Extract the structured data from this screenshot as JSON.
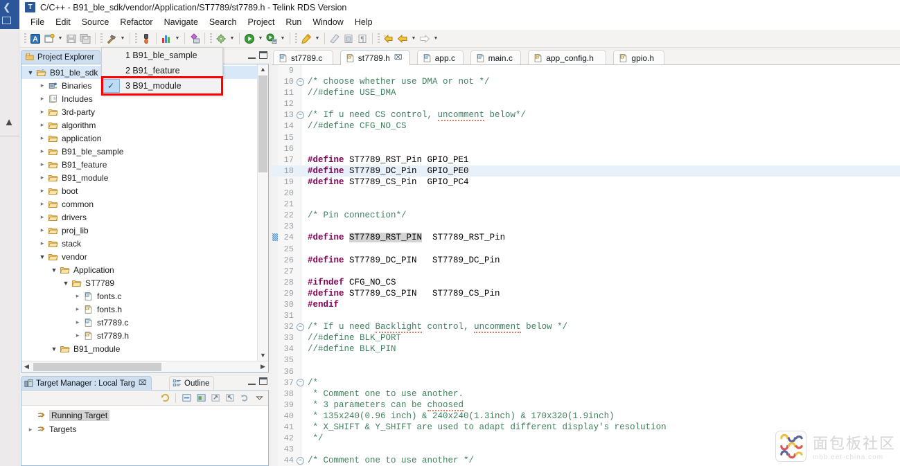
{
  "window": {
    "app_initial": "T",
    "title": "C/C++ - B91_ble_sdk/vendor/Application/ST7789/st7789.h - Telink RDS Version"
  },
  "menubar": {
    "items": [
      {
        "label": "File"
      },
      {
        "label": "Edit"
      },
      {
        "label": "Source"
      },
      {
        "label": "Refactor"
      },
      {
        "label": "Navigate"
      },
      {
        "label": "Search"
      },
      {
        "label": "Project"
      },
      {
        "label": "Run"
      },
      {
        "label": "Window"
      },
      {
        "label": "Help"
      }
    ]
  },
  "toolbar": {
    "icons": [
      "perspective-icon",
      "new-file-icon",
      "new-file-dropdown",
      "save-icon",
      "save-all-icon",
      "build-hammer-icon",
      "build-dropdown",
      "debug-flame-icon",
      "chart-icon",
      "chart-dropdown",
      "link-editor-icon",
      "build-settings-gear-icon",
      "build-settings-dropdown",
      "run-icon",
      "run-dropdown",
      "debug-icon",
      "debug-dropdown",
      "marker-icon",
      "marker-dropdown",
      "eraser-icon",
      "block-select-icon",
      "pilcrow-icon",
      "back-star-icon",
      "back-arrow-icon",
      "back-dropdown",
      "forward-arrow-icon",
      "forward-dropdown"
    ]
  },
  "dropdown": {
    "items": [
      {
        "label": "1 B91_ble_sample",
        "checked": false
      },
      {
        "label": "2 B91_feature",
        "checked": false
      },
      {
        "label": "3 B91_module",
        "checked": true
      }
    ],
    "check_glyph": "✓",
    "highlight_color": "#ff0000"
  },
  "project_explorer": {
    "tab_label": "Project Explorer",
    "tab_icon": "folder-explorer-icon",
    "minimize_label": "",
    "maximize_label": "",
    "tree": [
      {
        "label": "B91_ble_sdk",
        "depth": 0,
        "twisty": "open",
        "icon": "project-icon",
        "selected": true
      },
      {
        "label": "Binaries",
        "depth": 1,
        "twisty": "closed",
        "icon": "binaries-icon",
        "selected": false
      },
      {
        "label": "Includes",
        "depth": 1,
        "twisty": "closed",
        "icon": "includes-icon",
        "selected": false
      },
      {
        "label": "3rd-party",
        "depth": 1,
        "twisty": "closed",
        "icon": "folder-icon",
        "selected": false
      },
      {
        "label": "algorithm",
        "depth": 1,
        "twisty": "closed",
        "icon": "folder-icon",
        "selected": false
      },
      {
        "label": "application",
        "depth": 1,
        "twisty": "closed",
        "icon": "folder-icon",
        "selected": false
      },
      {
        "label": "B91_ble_sample",
        "depth": 1,
        "twisty": "closed",
        "icon": "folder-icon",
        "selected": false
      },
      {
        "label": "B91_feature",
        "depth": 1,
        "twisty": "closed",
        "icon": "folder-icon",
        "selected": false
      },
      {
        "label": "B91_module",
        "depth": 1,
        "twisty": "closed",
        "icon": "folder-icon",
        "selected": false
      },
      {
        "label": "boot",
        "depth": 1,
        "twisty": "closed",
        "icon": "folder-icon",
        "selected": false
      },
      {
        "label": "common",
        "depth": 1,
        "twisty": "closed",
        "icon": "folder-icon",
        "selected": false
      },
      {
        "label": "drivers",
        "depth": 1,
        "twisty": "closed",
        "icon": "folder-icon",
        "selected": false
      },
      {
        "label": "proj_lib",
        "depth": 1,
        "twisty": "closed",
        "icon": "folder-icon",
        "selected": false
      },
      {
        "label": "stack",
        "depth": 1,
        "twisty": "closed",
        "icon": "folder-icon",
        "selected": false
      },
      {
        "label": "vendor",
        "depth": 1,
        "twisty": "open",
        "icon": "folder-icon",
        "selected": false
      },
      {
        "label": "Application",
        "depth": 2,
        "twisty": "open",
        "icon": "folder-icon",
        "selected": false
      },
      {
        "label": "ST7789",
        "depth": 3,
        "twisty": "open",
        "icon": "folder-icon",
        "selected": false
      },
      {
        "label": "fonts.c",
        "depth": 4,
        "twisty": "closed",
        "icon": "c-file-icon",
        "selected": false
      },
      {
        "label": "fonts.h",
        "depth": 4,
        "twisty": "closed",
        "icon": "h-file-icon",
        "selected": false
      },
      {
        "label": "st7789.c",
        "depth": 4,
        "twisty": "closed",
        "icon": "c-file-icon",
        "selected": false
      },
      {
        "label": "st7789.h",
        "depth": 4,
        "twisty": "closed",
        "icon": "h-file-icon",
        "selected": false
      },
      {
        "label": "B91_module",
        "depth": 2,
        "twisty": "open",
        "icon": "folder-icon",
        "selected": false
      }
    ]
  },
  "target_manager": {
    "active_tab": "Target Manager : Local Targ",
    "active_tab_icon": "target-manager-icon",
    "active_tab_close": "⌧",
    "inactive_tab": "Outline",
    "inactive_tab_icon": "outline-icon",
    "toolbar_icons": [
      "refresh-targets-icon",
      "collapse-all-icon",
      "new-target-icon",
      "import-icon",
      "export-icon",
      "sync-icon",
      "view-menu-icon"
    ],
    "rows": [
      {
        "label": "Running Target",
        "icon": "target-icon",
        "twisty": "none",
        "selected": true
      },
      {
        "label": "Targets",
        "icon": "target-icon",
        "twisty": "closed",
        "selected": false
      }
    ]
  },
  "editor": {
    "tabs": [
      {
        "label": "st7789.c",
        "icon": "c-file-icon",
        "active": false,
        "dirty": false
      },
      {
        "label": "st7789.h",
        "icon": "h-file-icon",
        "active": true,
        "dirty": false,
        "close": "⌧"
      },
      {
        "label": "app.c",
        "icon": "c-file-icon",
        "active": false,
        "dirty": false
      },
      {
        "label": "main.c",
        "icon": "c-file-icon",
        "active": false,
        "dirty": false
      },
      {
        "label": "app_config.h",
        "icon": "h-file-icon",
        "active": false,
        "dirty": false
      },
      {
        "label": "gpio.h",
        "icon": "h-file-icon",
        "active": false,
        "dirty": false
      }
    ],
    "lines": [
      {
        "n": "9",
        "text": "",
        "fold": null,
        "hl": false
      },
      {
        "n": "10",
        "text": "/* choose whether use DMA or not */",
        "fold": "minus",
        "hl": false,
        "style": "comment"
      },
      {
        "n": "11",
        "text": "//#define USE_DMA",
        "fold": null,
        "hl": false,
        "style": "comment"
      },
      {
        "n": "12",
        "text": "",
        "fold": null,
        "hl": false
      },
      {
        "n": "13",
        "text": "/* If u need CS control, uncomment below*/",
        "fold": "minus",
        "hl": false,
        "style": "comment-spell",
        "spell": "uncomment"
      },
      {
        "n": "14",
        "text": "//#define CFG_NO_CS",
        "fold": null,
        "hl": false,
        "style": "comment"
      },
      {
        "n": "15",
        "text": "",
        "fold": null,
        "hl": false
      },
      {
        "n": "16",
        "text": "",
        "fold": null,
        "hl": false
      },
      {
        "n": "17",
        "text": "#define ST7789_RST_Pin GPIO_PE1",
        "fold": null,
        "hl": false,
        "style": "define"
      },
      {
        "n": "18",
        "text": "#define ST7789_DC_Pin  GPIO_PE0",
        "fold": null,
        "hl": true,
        "style": "define"
      },
      {
        "n": "19",
        "text": "#define ST7789_CS_Pin  GPIO_PC4",
        "fold": null,
        "hl": false,
        "style": "define"
      },
      {
        "n": "20",
        "text": "",
        "fold": null,
        "hl": false
      },
      {
        "n": "21",
        "text": "",
        "fold": null,
        "hl": false
      },
      {
        "n": "22",
        "text": "/* Pin connection*/",
        "fold": null,
        "hl": false,
        "style": "comment"
      },
      {
        "n": "23",
        "text": "",
        "fold": null,
        "hl": false
      },
      {
        "n": "24",
        "text": "#define ST7789_RST_PIN  ST7789_RST_Pin",
        "fold": null,
        "hl": false,
        "style": "define-occ",
        "occurrence": "ST7789_RST_PIN",
        "marker": true
      },
      {
        "n": "25",
        "text": "",
        "fold": null,
        "hl": false
      },
      {
        "n": "26",
        "text": "#define ST7789_DC_PIN   ST7789_DC_Pin",
        "fold": null,
        "hl": false,
        "style": "define"
      },
      {
        "n": "27",
        "text": "",
        "fold": null,
        "hl": false
      },
      {
        "n": "28",
        "text": "#ifndef CFG_NO_CS",
        "fold": null,
        "hl": false,
        "style": "define"
      },
      {
        "n": "29",
        "text": "#define ST7789_CS_PIN   ST7789_CS_Pin",
        "fold": null,
        "hl": false,
        "style": "define"
      },
      {
        "n": "30",
        "text": "#endif",
        "fold": null,
        "hl": false,
        "style": "define"
      },
      {
        "n": "31",
        "text": "",
        "fold": null,
        "hl": false
      },
      {
        "n": "32",
        "text": "/* If u need Backlight control, uncomment below */",
        "fold": "minus",
        "hl": false,
        "style": "comment-spell2"
      },
      {
        "n": "33",
        "text": "//#define BLK_PORT",
        "fold": null,
        "hl": false,
        "style": "comment"
      },
      {
        "n": "34",
        "text": "//#define BLK_PIN",
        "fold": null,
        "hl": false,
        "style": "comment"
      },
      {
        "n": "35",
        "text": "",
        "fold": null,
        "hl": false
      },
      {
        "n": "36",
        "text": "",
        "fold": null,
        "hl": false
      },
      {
        "n": "37",
        "text": "/*",
        "fold": "minus",
        "hl": false,
        "style": "comment"
      },
      {
        "n": "38",
        "text": " * Comment one to use another.",
        "fold": null,
        "hl": false,
        "style": "comment"
      },
      {
        "n": "39",
        "text": " * 3 parameters can be choosed",
        "fold": null,
        "hl": false,
        "style": "comment-spell3"
      },
      {
        "n": "40",
        "text": " * 135x240(0.96 inch) & 240x240(1.3inch) & 170x320(1.9inch)",
        "fold": null,
        "hl": false,
        "style": "comment"
      },
      {
        "n": "41",
        "text": " * X_SHIFT & Y_SHIFT are used to adapt different display's resolution",
        "fold": null,
        "hl": false,
        "style": "comment"
      },
      {
        "n": "42",
        "text": " */",
        "fold": null,
        "hl": false,
        "style": "comment"
      },
      {
        "n": "43",
        "text": "",
        "fold": null,
        "hl": false
      },
      {
        "n": "44",
        "text": "/* Comment one to use another */",
        "fold": "minus",
        "hl": false,
        "style": "comment"
      }
    ]
  },
  "watermark": {
    "cn": "面包板社区",
    "en": "mbb.eet-china.com"
  }
}
